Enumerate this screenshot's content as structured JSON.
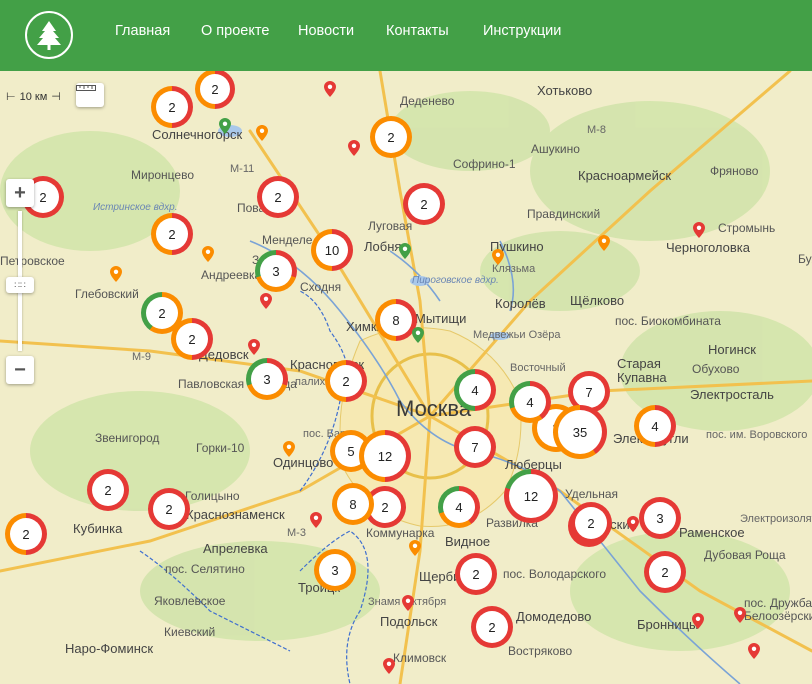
{
  "header": {
    "nav": [
      "Главная",
      "О проекте",
      "Новости",
      "Контакты",
      "Инструкции"
    ]
  },
  "colors": {
    "header": "#43a047",
    "red": "#e53935",
    "orange": "#fb8c00",
    "green": "#43a047"
  },
  "controls": {
    "scale_label": "10 км",
    "zoom_in": "+",
    "zoom_out": "−",
    "ruler_icon": "ruler-icon"
  },
  "map": {
    "capital": "Москва",
    "places": [
      "Хотьково",
      "Деденево",
      "М-8",
      "Солнечногорск",
      "Ашукино",
      "Софрино-1",
      "Красноармейск",
      "Фряново",
      "Миронцево",
      "М-11",
      "Истринское вдхр.",
      "Поварово",
      "Правдинский",
      "Луговая",
      "Стромынь",
      "Черноголовка",
      "Менделе",
      "Лобня",
      "Пушкино",
      "Андреевка",
      "Клязьма",
      "Петровское",
      "Зел",
      "Сходня",
      "Пироговское вдхр.",
      "Глебовский",
      "Королёв",
      "Щёлково",
      "Химки",
      "Мытищи",
      "Медвежьи Озёра",
      "пос. Биокомбината",
      "М-9",
      "Ногинск",
      "Старая",
      "Купавна",
      "Обухово",
      "Восточный",
      "Дедовск",
      "Красногорск",
      "Павловская Слобода",
      "палих",
      "Электросталь",
      "Звенигород",
      "пос. Барви",
      "Электроугли",
      "пос. им. Воровского",
      "Горки-10",
      "Одинцово",
      "Люберцы",
      "Удельная",
      "Голицыно",
      "Краснознаменск",
      "Кубинка",
      "Жуковский",
      "Развилка",
      "Раменское",
      "М-3",
      "Коммунарка",
      "Видное",
      "Апрелевка",
      "пос. Селятино",
      "Дубовая Роща",
      "пос. Володарского",
      "Щербинка",
      "Троицк",
      "Яковлевское",
      "Знамя Октября",
      "пос. Дружба",
      "Белоозёрский",
      "Киевский",
      "Наро-Фоминск",
      "Подольск",
      "Домодедово",
      "Бронницы",
      "Востряково",
      "Климовск",
      "Электроизолятор",
      "Бужв"
    ],
    "clusters": [
      "2",
      "2",
      "2",
      "2",
      "2",
      "2",
      "2",
      "10",
      "3",
      "2",
      "3",
      "8",
      "2",
      "2",
      "2",
      "4",
      "4",
      "7",
      "7",
      "35",
      "4",
      "5",
      "12",
      "7",
      "2",
      "8",
      "2",
      "4",
      "12",
      "2",
      "2",
      "2",
      "3",
      "2",
      "2",
      "2",
      "3",
      "2",
      "2"
    ]
  }
}
